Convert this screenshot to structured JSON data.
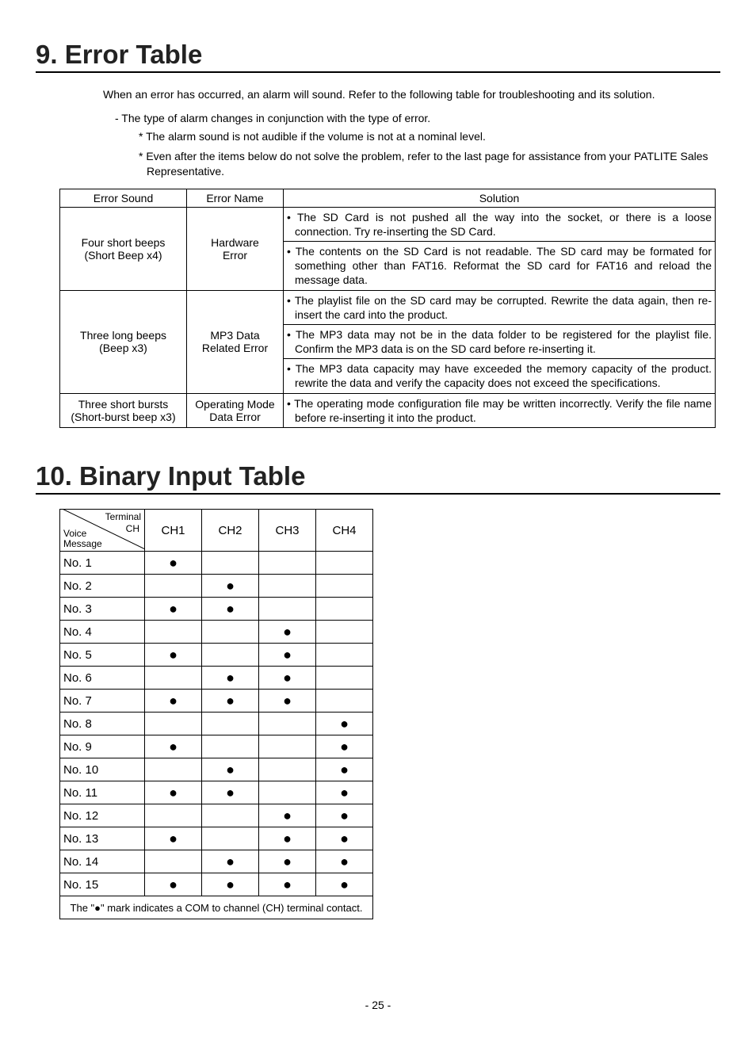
{
  "section9": {
    "heading": "9. Error Table",
    "intro": "When an error has occurred, an alarm will sound.  Refer to the following table for troubleshooting and its solution.",
    "note1": "- The type of alarm changes in conjunction with the type of error.",
    "note2": "* The alarm sound is not audible if the volume is not at a nominal level.",
    "note3": "* Even after the items below do not solve the problem, refer to the last page for assistance from your PATLITE Sales Representative.",
    "headers": {
      "c1": "Error Sound",
      "c2": "Error Name",
      "c3": "Solution"
    },
    "rows": [
      {
        "sound_l1": "Four short beeps",
        "sound_l2": "(Short Beep x4)",
        "name_l1": "Hardware",
        "name_l2": "Error",
        "solutions": [
          "The SD Card is not pushed all the way into the socket, or there is a loose connection. Try re-inserting the SD Card.",
          "The contents on the SD Card is not readable.  The SD card may be formated for something other than FAT16.  Reformat the SD card for FAT16 and reload the message data."
        ]
      },
      {
        "sound_l1": "Three long beeps",
        "sound_l2": "(Beep x3)",
        "name_l1": "MP3 Data",
        "name_l2": "Related Error",
        "solutions": [
          "The playlist file on the SD card may be corrupted.  Rewrite the data again, then re-insert the card into the product.",
          "The MP3 data may not be in the data folder to be registered for the playlist file. Confirm the MP3 data is on the SD card before re-inserting it.",
          "The MP3 data capacity may have exceeded the memory capacity of the product.  rewrite the data and verify the capacity does not exceed the specifications."
        ]
      },
      {
        "sound_l1": "Three short bursts",
        "sound_l2": "(Short-burst beep x3)",
        "name_l1": "Operating Mode",
        "name_l2": "Data Error",
        "solutions": [
          "The operating mode configuration file may be written incorrectly.  Verify the file name before re-inserting it into the product."
        ]
      }
    ]
  },
  "section10": {
    "heading": "10. Binary Input Table",
    "diag": {
      "top": "Terminal",
      "mid": "CH",
      "bl1": "Voice",
      "bl2": "Message"
    },
    "ch_headers": [
      "CH1",
      "CH2",
      "CH3",
      "CH4"
    ],
    "rows": [
      {
        "label": "No. 1",
        "ch": [
          true,
          false,
          false,
          false
        ]
      },
      {
        "label": "No. 2",
        "ch": [
          false,
          true,
          false,
          false
        ]
      },
      {
        "label": "No. 3",
        "ch": [
          true,
          true,
          false,
          false
        ]
      },
      {
        "label": "No. 4",
        "ch": [
          false,
          false,
          true,
          false
        ]
      },
      {
        "label": "No. 5",
        "ch": [
          true,
          false,
          true,
          false
        ]
      },
      {
        "label": "No. 6",
        "ch": [
          false,
          true,
          true,
          false
        ]
      },
      {
        "label": "No. 7",
        "ch": [
          true,
          true,
          true,
          false
        ]
      },
      {
        "label": "No. 8",
        "ch": [
          false,
          false,
          false,
          true
        ]
      },
      {
        "label": "No. 9",
        "ch": [
          true,
          false,
          false,
          true
        ]
      },
      {
        "label": "No. 10",
        "ch": [
          false,
          true,
          false,
          true
        ]
      },
      {
        "label": "No. 11",
        "ch": [
          true,
          true,
          false,
          true
        ]
      },
      {
        "label": "No. 12",
        "ch": [
          false,
          false,
          true,
          true
        ]
      },
      {
        "label": "No. 13",
        "ch": [
          true,
          false,
          true,
          true
        ]
      },
      {
        "label": "No. 14",
        "ch": [
          false,
          true,
          true,
          true
        ]
      },
      {
        "label": "No. 15",
        "ch": [
          true,
          true,
          true,
          true
        ]
      }
    ],
    "footnote": "The \"●\" mark indicates a COM to channel (CH) terminal contact."
  },
  "page_number": "- 25 -"
}
